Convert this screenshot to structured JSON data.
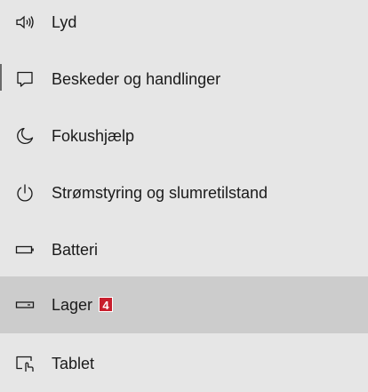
{
  "nav": {
    "items": [
      {
        "label": "Lyd",
        "icon": "speaker-icon"
      },
      {
        "label": "Beskeder og handlinger",
        "icon": "message-icon"
      },
      {
        "label": "Fokushjælp",
        "icon": "moon-icon"
      },
      {
        "label": "Strømstyring og slumretilstand",
        "icon": "power-icon"
      },
      {
        "label": "Batteri",
        "icon": "battery-icon"
      },
      {
        "label": "Lager",
        "icon": "storage-icon",
        "badge": "4",
        "selected": true
      },
      {
        "label": "Tablet",
        "icon": "tablet-icon"
      }
    ]
  },
  "colors": {
    "background": "#e6e6e6",
    "selected_background": "#cccccc",
    "badge": "#c81e2d"
  }
}
